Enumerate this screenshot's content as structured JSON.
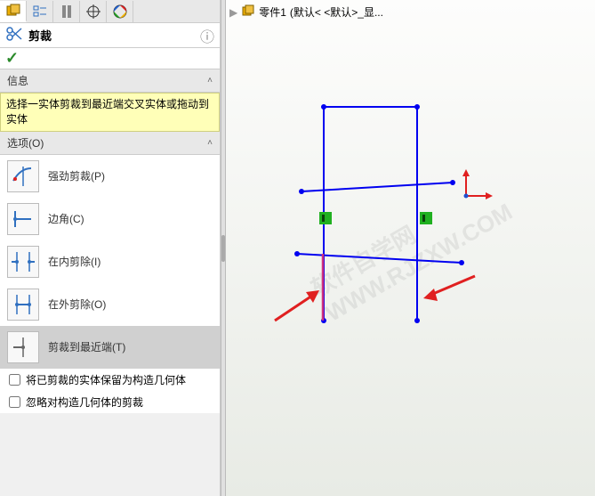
{
  "header": {
    "title": "剪裁"
  },
  "sections": {
    "info": {
      "title": "信息",
      "message": "选择一实体剪裁到最近端交叉实体或拖动到实体"
    },
    "options": {
      "title": "选项(O)",
      "items": [
        {
          "label": "强劲剪裁(P)"
        },
        {
          "label": "边角(C)"
        },
        {
          "label": "在内剪除(I)"
        },
        {
          "label": "在外剪除(O)"
        },
        {
          "label": "剪裁到最近端(T)"
        }
      ],
      "checkboxes": [
        {
          "label": "将已剪裁的实体保留为构造几何体"
        },
        {
          "label": "忽略对构造几何体的剪裁"
        }
      ]
    }
  },
  "breadcrumb": {
    "part": "零件1",
    "state": "(默认< <默认>_显..."
  },
  "watermark": "软件自学网 WWW.RJZXW.COM",
  "colors": {
    "accent": "#f0b000",
    "sketch": "#0000f0",
    "select": "#d03080",
    "green": "#20b020",
    "red": "#e02020"
  }
}
